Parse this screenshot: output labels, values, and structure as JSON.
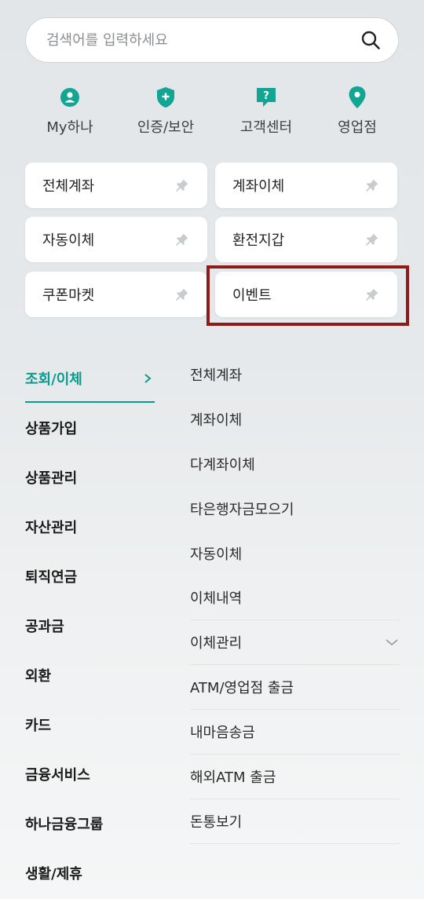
{
  "search": {
    "placeholder": "검색어를 입력하세요",
    "value": ""
  },
  "quick_menu": [
    {
      "label": "My하나",
      "icon": "person-icon"
    },
    {
      "label": "인증/보안",
      "icon": "shield-plus-icon"
    },
    {
      "label": "고객센터",
      "icon": "help-chat-icon"
    },
    {
      "label": "영업점",
      "icon": "location-pin-icon"
    }
  ],
  "favorites": [
    {
      "label": "전체계좌"
    },
    {
      "label": "계좌이체"
    },
    {
      "label": "자동이체"
    },
    {
      "label": "환전지갑"
    },
    {
      "label": "쿠폰마켓"
    },
    {
      "label": "이벤트"
    }
  ],
  "categories": [
    {
      "label": "조회/이체",
      "active": true
    },
    {
      "label": "상품가입"
    },
    {
      "label": "상품관리"
    },
    {
      "label": "자산관리"
    },
    {
      "label": "퇴직연금"
    },
    {
      "label": "공과금"
    },
    {
      "label": "외환"
    },
    {
      "label": "카드"
    },
    {
      "label": "금융서비스"
    },
    {
      "label": "하나금융그룹"
    },
    {
      "label": "생활/제휴"
    }
  ],
  "submenu": [
    {
      "label": "전체계좌"
    },
    {
      "label": "계좌이체"
    },
    {
      "label": "다계좌이체"
    },
    {
      "label": "타은행자금모으기"
    },
    {
      "label": "자동이체"
    },
    {
      "label": "이체내역"
    },
    {
      "label": "이체관리",
      "expandable": true
    },
    {
      "label": "ATM/영업점 출금"
    },
    {
      "label": "내마음송금"
    },
    {
      "label": "해외ATM 출금"
    },
    {
      "label": "돈통보기"
    }
  ],
  "colors": {
    "accent": "#0b9a8d",
    "highlight_border": "#8e1a1a",
    "pin_gray": "#c8cccf"
  }
}
